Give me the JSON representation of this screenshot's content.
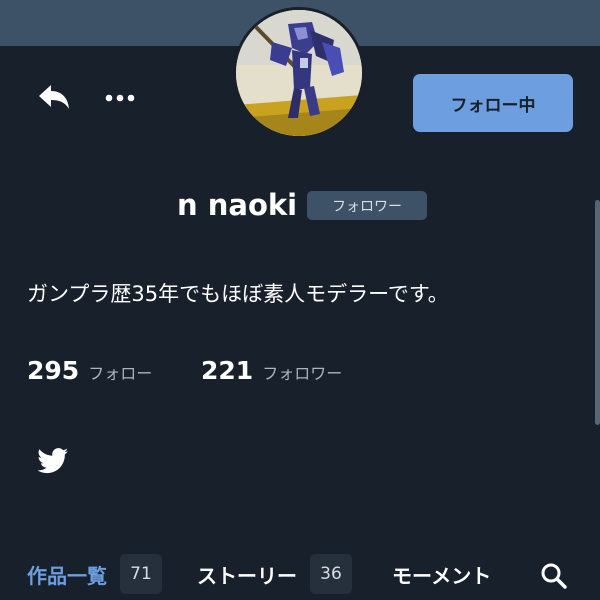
{
  "colors": {
    "background": "#17202b",
    "header_band": "#3d5266",
    "accent": "#6d9fe0",
    "text_primary": "#ffffff",
    "text_secondary": "#aab4bf",
    "badge_bg": "#3d5266",
    "count_bg": "#26303c"
  },
  "toolbar": {
    "back_icon": "reply-arrow-icon",
    "more_icon": "more-dots-icon"
  },
  "profile": {
    "avatar_icon": "gundam-model-avatar",
    "display_name": "n naoki",
    "follows_you_badge": "フォロワー",
    "follow_button_label": "フォロー中",
    "bio": "ガンプラ歴35年でもほぼ素人モデラーです。",
    "social_icon": "twitter-bird-icon"
  },
  "stats": {
    "following": {
      "count": "295",
      "label": "フォロー"
    },
    "followers": {
      "count": "221",
      "label": "フォロワー"
    }
  },
  "tabs": [
    {
      "label": "作品一覧",
      "count": "71",
      "active": true
    },
    {
      "label": "ストーリー",
      "count": "36",
      "active": false
    },
    {
      "label": "モーメント",
      "active": false
    }
  ],
  "search_icon": "search-icon"
}
